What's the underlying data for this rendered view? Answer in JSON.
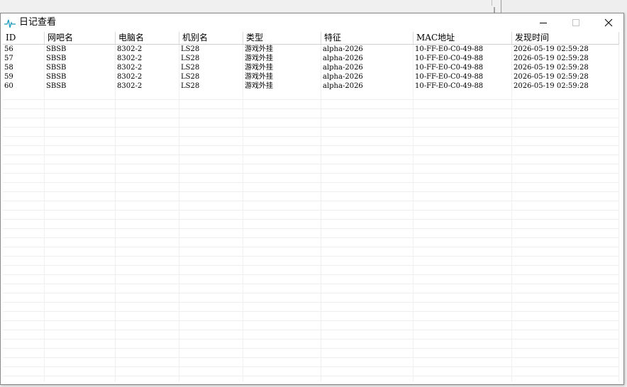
{
  "window": {
    "title": "日记查看"
  },
  "icons": {
    "app": "pulse-icon",
    "minimize": "minimize-icon",
    "maximize": "maximize-icon",
    "close": "close-icon"
  },
  "colors": {
    "app_icon": "#1e9bbf"
  },
  "table": {
    "columns": [
      "ID",
      "网吧名",
      "电脑名",
      "机别名",
      "类型",
      "特征",
      "MAC地址",
      "发现时间"
    ],
    "rows": [
      [
        "56",
        "SBSB",
        "8302-2",
        "LS28",
        "游戏外挂",
        "alpha-2026",
        "10-FF-E0-C0-49-88",
        "2026-05-19 02:59:28"
      ],
      [
        "57",
        "SBSB",
        "8302-2",
        "LS28",
        "游戏外挂",
        "alpha-2026",
        "10-FF-E0-C0-49-88",
        "2026-05-19 02:59:28"
      ],
      [
        "58",
        "SBSB",
        "8302-2",
        "LS28",
        "游戏外挂",
        "alpha-2026",
        "10-FF-E0-C0-49-88",
        "2026-05-19 02:59:28"
      ],
      [
        "59",
        "SBSB",
        "8302-2",
        "LS28",
        "游戏外挂",
        "alpha-2026",
        "10-FF-E0-C0-49-88",
        "2026-05-19 02:59:28"
      ],
      [
        "60",
        "SBSB",
        "8302-2",
        "LS28",
        "游戏外挂",
        "alpha-2026",
        "10-FF-E0-C0-49-88",
        "2026-05-19 02:59:28"
      ]
    ]
  }
}
